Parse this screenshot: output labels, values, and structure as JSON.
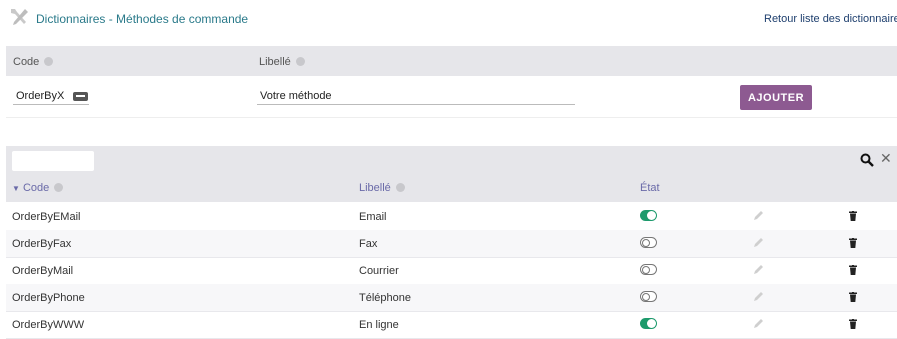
{
  "header": {
    "title": "Dictionnaires - Méthodes de commande",
    "back_link": "Retour liste des dictionnaires"
  },
  "add_form": {
    "code_header": "Code",
    "label_header": "Libellé",
    "code_value": "OrderByX",
    "label_value": "Votre méthode",
    "add_button": "AJOUTER"
  },
  "list": {
    "filter_value": "",
    "columns": {
      "code": "Code",
      "label": "Libellé",
      "state": "État"
    },
    "sort_column": "code",
    "rows": [
      {
        "code": "OrderByEMail",
        "label": "Email",
        "active": true
      },
      {
        "code": "OrderByFax",
        "label": "Fax",
        "active": false
      },
      {
        "code": "OrderByMail",
        "label": "Courrier",
        "active": false
      },
      {
        "code": "OrderByPhone",
        "label": "Téléphone",
        "active": false
      },
      {
        "code": "OrderByWWW",
        "label": "En ligne",
        "active": true
      }
    ]
  },
  "colors": {
    "accent_button": "#8d5a91",
    "toggle_on": "#1d9a6c",
    "title": "#2a7a8a"
  },
  "icons": [
    "tools-icon",
    "info-icon",
    "keyboard-icon",
    "search-icon",
    "close-icon",
    "sort-down-icon",
    "pencil-icon",
    "trash-icon",
    "toggle-on-icon",
    "toggle-off-icon"
  ]
}
